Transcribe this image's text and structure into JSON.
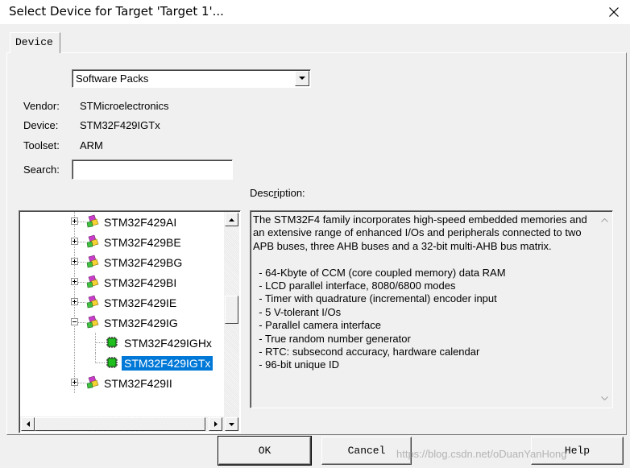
{
  "window": {
    "title": "Select Device for Target 'Target 1'..."
  },
  "tabs": [
    {
      "label": "Device"
    }
  ],
  "device_list_source": {
    "selected": "Software Packs"
  },
  "info": {
    "vendor_label": "Vendor:",
    "vendor_value": "STMicroelectronics",
    "device_label": "Device:",
    "device_value": "STM32F429IGTx",
    "toolset_label": "Toolset:",
    "toolset_value": "ARM",
    "search_label": "Search:",
    "search_value": ""
  },
  "description": {
    "label_prefix": "Desc",
    "label_accel": "r",
    "label_suffix": "iption:",
    "text": "The STM32F4 family incorporates high-speed embedded memories and an extensive range of enhanced I/Os and peripherals connected to two APB buses, three AHB buses and a 32-bit multi-AHB bus matrix.\n\n  - 64-Kbyte of CCM (core coupled memory) data RAM\n  - LCD parallel interface, 8080/6800 modes\n  - Timer with quadrature (incremental) encoder input\n  - 5 V-tolerant I/Os\n  - Parallel camera interface\n  - True random number generator\n  - RTC: subsecond accuracy, hardware calendar\n  - 96-bit unique ID"
  },
  "tree": {
    "items": [
      {
        "label": "STM32F429AI",
        "level": 1,
        "expanded": false,
        "selected": false,
        "icon": "device-family-icon"
      },
      {
        "label": "STM32F429BE",
        "level": 1,
        "expanded": false,
        "selected": false,
        "icon": "device-family-icon"
      },
      {
        "label": "STM32F429BG",
        "level": 1,
        "expanded": false,
        "selected": false,
        "icon": "device-family-icon"
      },
      {
        "label": "STM32F429BI",
        "level": 1,
        "expanded": false,
        "selected": false,
        "icon": "device-family-icon"
      },
      {
        "label": "STM32F429IE",
        "level": 1,
        "expanded": false,
        "selected": false,
        "icon": "device-family-icon"
      },
      {
        "label": "STM32F429IG",
        "level": 1,
        "expanded": true,
        "selected": false,
        "icon": "device-family-icon"
      },
      {
        "label": "STM32F429IGHx",
        "level": 2,
        "selected": false,
        "icon": "chip-icon"
      },
      {
        "label": "STM32F429IGTx",
        "level": 2,
        "selected": true,
        "icon": "chip-icon"
      },
      {
        "label": "STM32F429II",
        "level": 1,
        "expanded": false,
        "selected": false,
        "icon": "device-family-icon"
      }
    ]
  },
  "buttons": {
    "ok": "OK",
    "cancel": "Cancel",
    "help": "Help"
  },
  "watermark": "https://blog.csdn.net/oDuanYanHong",
  "colors": {
    "selection": "#0078d7",
    "dialog_bg": "#f0f0f0"
  }
}
